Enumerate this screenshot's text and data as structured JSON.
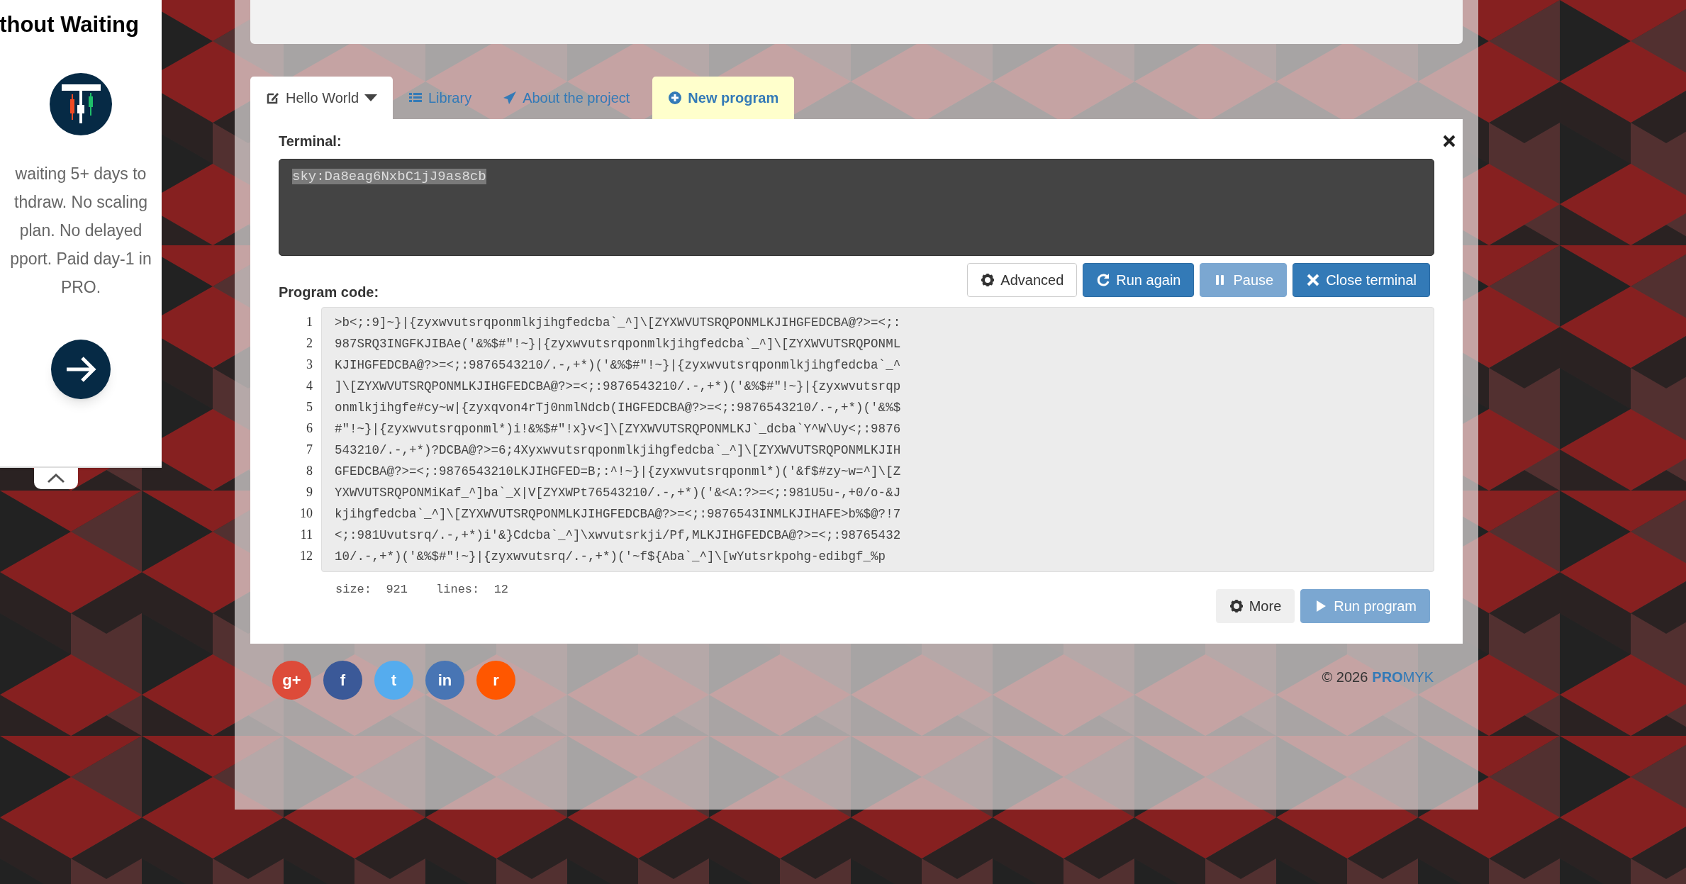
{
  "side_panel": {
    "title": "thout Waiting",
    "text_lines": [
      "waiting 5+ days to",
      "thdraw. No scaling",
      "plan. No delayed",
      "pport. Paid day-1 in",
      "PRO."
    ]
  },
  "tabs": [
    {
      "label": "Hello World",
      "kind": "dropdown",
      "selected": true
    },
    {
      "label": "Library",
      "kind": "link",
      "selected": false
    },
    {
      "label": "About the project",
      "kind": "link",
      "selected": false
    },
    {
      "label": "New program",
      "kind": "new",
      "selected": false
    }
  ],
  "terminal": {
    "label": "Terminal:",
    "output": "sky:Da8eag6NxbC1jJ9as8cb",
    "highlighted": true
  },
  "toolbar_buttons": [
    {
      "label": "Advanced",
      "kind": "default",
      "disabled": false
    },
    {
      "label": "Run again",
      "kind": "primary",
      "disabled": false
    },
    {
      "label": "Pause",
      "kind": "primary",
      "disabled": true
    },
    {
      "label": "Close terminal",
      "kind": "primary",
      "disabled": false
    }
  ],
  "program_code": {
    "label": "Program code:",
    "lines": [
      {
        "number": "1",
        "code": ">b<;:9]~}|{zyxwvutsrqponmlkjihgfedcba`_^]\\[ZYXWVUTSRQPONMLKJIHGFEDCBA@?>=<;:"
      },
      {
        "number": "2",
        "code": "987SRQ3INGFKJIBAe('&%$#\"!~}|{zyxwvutsrqponmlkjihgfedcba`_^]\\[ZYXWVUTSRQPONML"
      },
      {
        "number": "3",
        "code": "KJIHGFEDCBA@?>=<;:9876543210/.-,+*)('&%$#\"!~}|{zyxwvutsrqponmlkjihgfedcba`_^"
      },
      {
        "number": "4",
        "code": "]\\[ZYXWVUTSRQPONMLKJIHGFEDCBA@?>=<;:9876543210/.-,+*)('&%$#\"!~}|{zyxwvutsrqp"
      },
      {
        "number": "5",
        "code": "onmlkjihgfe#cy~w|{zyxqvon4rTj0nmlNdcb(IHGFEDCBA@?>=<;:9876543210/.-,+*)('&%$"
      },
      {
        "number": "6",
        "code": "#\"!~}|{zyxwvutsrqponml*)i!&%$#\"!x}v<]\\[ZYXWVUTSRQPONMLKJ`_dcba`Y^W\\Uy<;:9876"
      },
      {
        "number": "7",
        "code": "543210/.-,+*)?DCBA@?>=6;4Xyxwvutsrqponmlkjihgfedcba`_^]\\[ZYXWVUTSRQPONMLKJIH"
      },
      {
        "number": "8",
        "code": "GFEDCBA@?>=<;:9876543210LKJIHGFED=B;:^!~}|{zyxwvutsrqponml*)('&f$#zy~w=^]\\[Z"
      },
      {
        "number": "9",
        "code": "YXWVUTSRQPONMiKaf_^]ba`_X|V[ZYXWPt76543210/.-,+*)('&<A:?>=<;:981U5u-,+0/o-&J"
      },
      {
        "number": "10",
        "code": "kjihgfedcba`_^]\\[ZYXWVUTSRQPONMLKJIHGFEDCBA@?>=<;:9876543INMLKJIHAFE>b%$@?!7"
      },
      {
        "number": "11",
        "code": "<;:981Uvutsrq/.-,+*)i'&}Cdcba`_^]\\xwvutsrkji/Pf,MLKJIHGFEDCBA@?>=<;:98765432"
      },
      {
        "number": "12",
        "code": "10/.-,+*)('&%$#\"!~}|{zyxwvutsrq/.-,+*)('~f${Aba`_^]\\[wYutsrkpohg-edibgf_%p"
      }
    ]
  },
  "stats": [
    {
      "label": "size:",
      "value": "921"
    },
    {
      "label": "lines:",
      "value": "12"
    }
  ],
  "bottom_buttons": [
    {
      "label": "More",
      "kind": "light",
      "disabled": false
    },
    {
      "label": "Run program",
      "kind": "primary",
      "disabled": true
    }
  ],
  "social": [
    {
      "label": "g+",
      "color": "#dd4b39"
    },
    {
      "label": "f",
      "color": "#3b5998"
    },
    {
      "label": "t",
      "color": "#55acee"
    },
    {
      "label": "in",
      "color": "#4875b4"
    },
    {
      "label": "r",
      "color": "#ff5700"
    }
  ],
  "footer": {
    "copyright": "© 2026",
    "brand_bold": "PRO",
    "brand_rest": "MYK"
  }
}
